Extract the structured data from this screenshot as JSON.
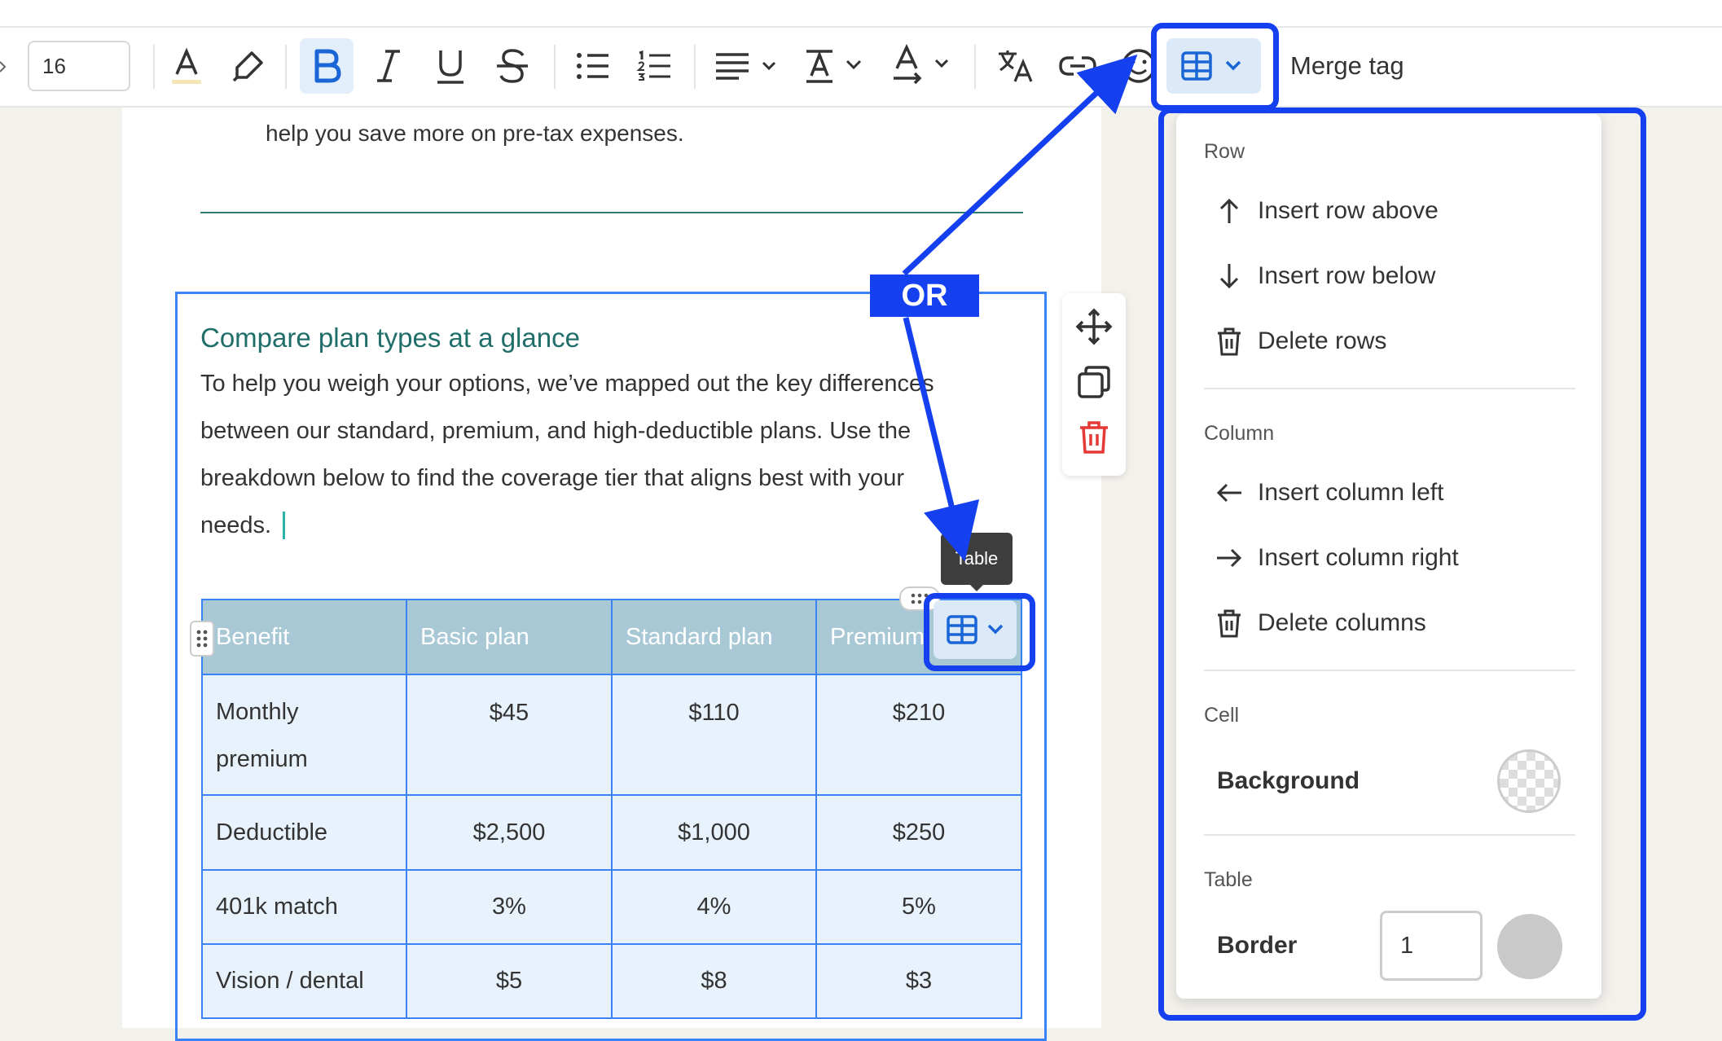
{
  "toolbar": {
    "font_size": "16",
    "merge_tag_label": "Merge tag",
    "icons": [
      "text-color-icon",
      "highlighter-icon",
      "bold-icon",
      "italic-icon",
      "underline-icon",
      "strikethrough-icon",
      "bullet-list-icon",
      "numbered-list-icon",
      "align-icon",
      "text-size-icon",
      "text-direction-icon",
      "translate-icon",
      "link-icon",
      "emoji-icon",
      "table-icon"
    ]
  },
  "document": {
    "intro_text": "help you save more on pre-tax expenses.",
    "heading": "Compare plan types at a glance",
    "paragraph_lines": [
      "To help you weigh your options, we’ve mapped out the key differences",
      "between our standard, premium, and high-deductible plans. Use the",
      "breakdown below to find the coverage tier that aligns best with your",
      "needs."
    ]
  },
  "table": {
    "headers": [
      "Benefit",
      "Basic plan",
      "Standard plan",
      "Premium"
    ],
    "rows": [
      [
        "Monthly premium",
        "$45",
        "$110",
        "$210"
      ],
      [
        "Deductible",
        "$2,500",
        "$1,000",
        "$250"
      ],
      [
        "401k match",
        "3%",
        "4%",
        "5%"
      ],
      [
        "Vision / dental",
        "$5",
        "$8",
        "$3"
      ]
    ],
    "tooltip": "Table"
  },
  "annotation": {
    "or_label": "OR",
    "highlight_color": "#1540f0"
  },
  "menu": {
    "row_section": "Row",
    "insert_row_above": "Insert row above",
    "insert_row_below": "Insert row below",
    "delete_rows": "Delete rows",
    "column_section": "Column",
    "insert_column_left": "Insert column left",
    "insert_column_right": "Insert column right",
    "delete_columns": "Delete columns",
    "cell_section": "Cell",
    "background_label": "Background",
    "table_section": "Table",
    "border_label": "Border",
    "border_value": "1"
  },
  "colors": {
    "accent": "#3b82f6",
    "heading": "#1f6e6a",
    "table_header": "#a8c8d5",
    "table_cell": "#e8f2fc",
    "delete_red": "#e53935"
  }
}
